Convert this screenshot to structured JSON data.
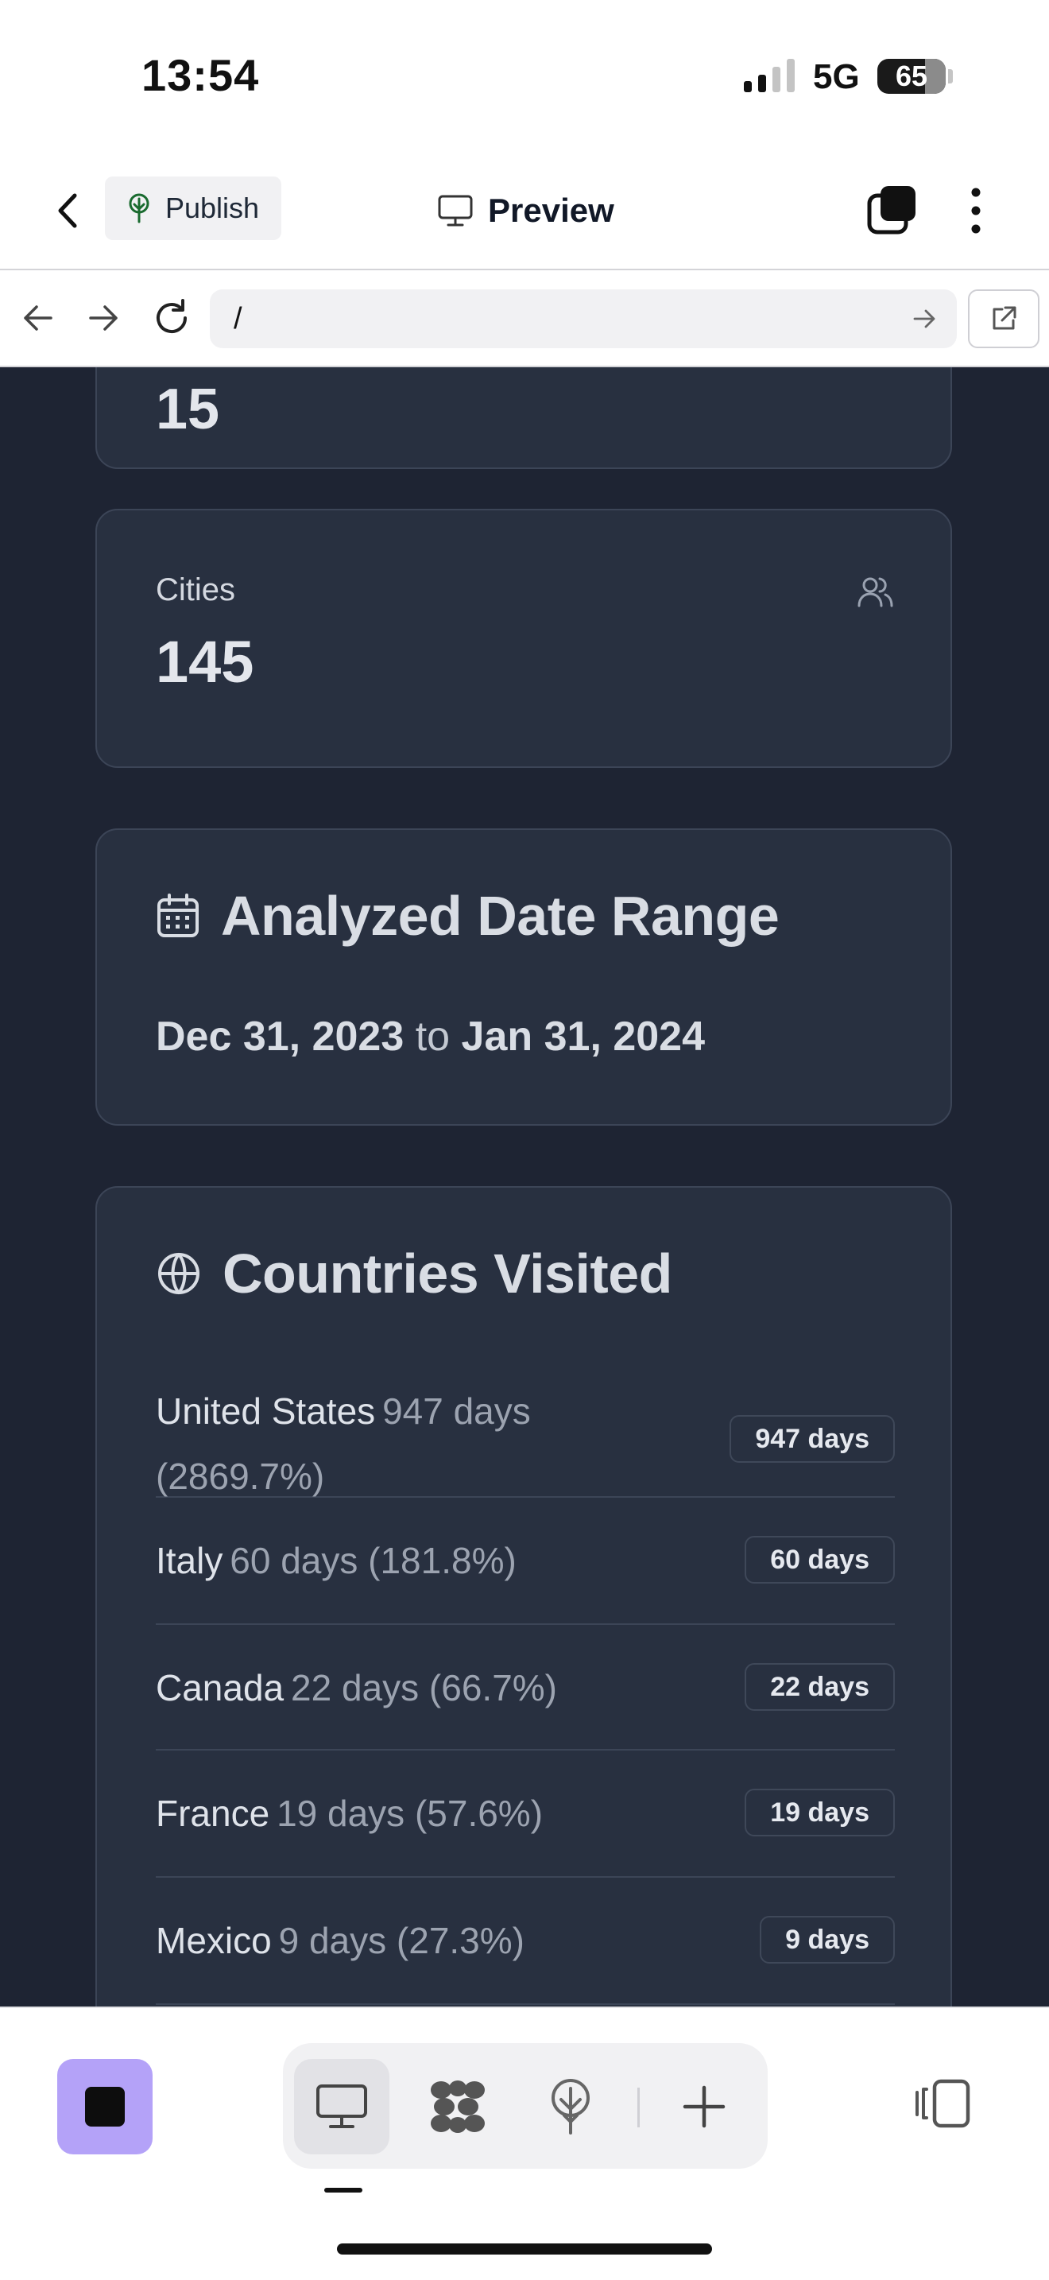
{
  "status_bar": {
    "time": "13:54",
    "network": "5G",
    "battery": "65"
  },
  "header": {
    "publish_label": "Publish",
    "preview_label": "Preview"
  },
  "url_bar": {
    "url": "/"
  },
  "stats": {
    "partial_value": "15",
    "cities_label": "Cities",
    "cities_value": "145"
  },
  "date_range": {
    "title": "Analyzed Date Range",
    "start": "Dec 31, 2023",
    "separator": "to",
    "end": "Jan 31, 2024"
  },
  "countries": {
    "title": "Countries Visited",
    "items": [
      {
        "name": "United States",
        "detail_line1": "947 days",
        "detail_line2": "(2869.7%)",
        "badge": "947 days"
      },
      {
        "name": "Italy",
        "detail": "60 days (181.8%)",
        "badge": "60 days"
      },
      {
        "name": "Canada",
        "detail": "22 days (66.7%)",
        "badge": "22 days"
      },
      {
        "name": "France",
        "detail": "19 days (57.6%)",
        "badge": "19 days"
      },
      {
        "name": "Mexico",
        "detail": "9 days (27.3%)",
        "badge": "9 days"
      }
    ]
  },
  "icons": {
    "back": "chevron-left-icon",
    "publish": "tree-icon",
    "preview": "monitor-icon",
    "tabs": "tabs-icon",
    "more": "more-vertical-icon",
    "nav_back": "arrow-left-icon",
    "nav_forward": "arrow-right-icon",
    "reload": "reload-icon",
    "go": "arrow-right-icon",
    "open_external": "external-link-icon",
    "users": "users-icon",
    "calendar": "calendar-icon",
    "globe": "globe-icon",
    "stop": "stop-icon",
    "desktop": "monitor-icon",
    "grid": "blob-grid-icon",
    "deploy": "tree-icon",
    "add": "plus-icon",
    "panel": "panel-toggle-icon"
  },
  "colors": {
    "content_background": "#1e2433",
    "card_background": "#283040",
    "accent_stop": "#b4a2f8"
  }
}
